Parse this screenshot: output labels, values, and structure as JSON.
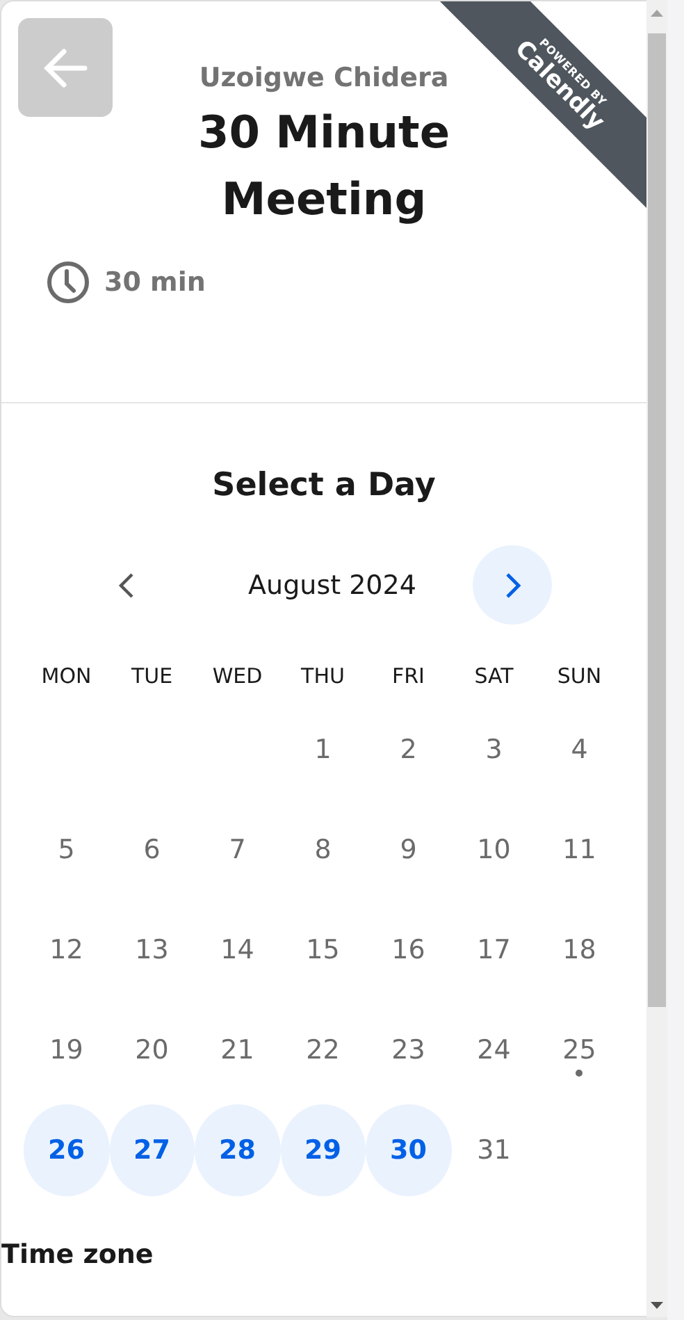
{
  "ribbon": {
    "small": "POWERED BY",
    "brand": "Calendly"
  },
  "event": {
    "host": "Uzoigwe Chidera",
    "title": "30 Minute Meeting",
    "duration": "30 min"
  },
  "calendar": {
    "heading": "Select a Day",
    "month": "August 2024",
    "weekdays": [
      "MON",
      "TUE",
      "WED",
      "THU",
      "FRI",
      "SAT",
      "SUN"
    ],
    "weeks": [
      [
        {
          "day": "1",
          "available": false,
          "today": false
        },
        {
          "day": "2",
          "available": false,
          "today": false
        },
        {
          "day": "3",
          "available": false,
          "today": false
        },
        {
          "day": "4",
          "available": false,
          "today": false
        }
      ],
      [
        {
          "day": "5",
          "available": false,
          "today": false
        },
        {
          "day": "6",
          "available": false,
          "today": false
        },
        {
          "day": "7",
          "available": false,
          "today": false
        },
        {
          "day": "8",
          "available": false,
          "today": false
        },
        {
          "day": "9",
          "available": false,
          "today": false
        },
        {
          "day": "10",
          "available": false,
          "today": false
        },
        {
          "day": "11",
          "available": false,
          "today": false
        }
      ],
      [
        {
          "day": "12",
          "available": false,
          "today": false
        },
        {
          "day": "13",
          "available": false,
          "today": false
        },
        {
          "day": "14",
          "available": false,
          "today": false
        },
        {
          "day": "15",
          "available": false,
          "today": false
        },
        {
          "day": "16",
          "available": false,
          "today": false
        },
        {
          "day": "17",
          "available": false,
          "today": false
        },
        {
          "day": "18",
          "available": false,
          "today": false
        }
      ],
      [
        {
          "day": "19",
          "available": false,
          "today": false
        },
        {
          "day": "20",
          "available": false,
          "today": false
        },
        {
          "day": "21",
          "available": false,
          "today": false
        },
        {
          "day": "22",
          "available": false,
          "today": false
        },
        {
          "day": "23",
          "available": false,
          "today": false
        },
        {
          "day": "24",
          "available": false,
          "today": false
        },
        {
          "day": "25",
          "available": false,
          "today": true
        }
      ],
      [
        {
          "day": "26",
          "available": true,
          "today": false
        },
        {
          "day": "27",
          "available": true,
          "today": false
        },
        {
          "day": "28",
          "available": true,
          "today": false
        },
        {
          "day": "29",
          "available": true,
          "today": false
        },
        {
          "day": "30",
          "available": true,
          "today": false
        },
        {
          "day": "31",
          "available": false,
          "today": false
        }
      ]
    ]
  },
  "timezone": {
    "label": "Time zone"
  }
}
